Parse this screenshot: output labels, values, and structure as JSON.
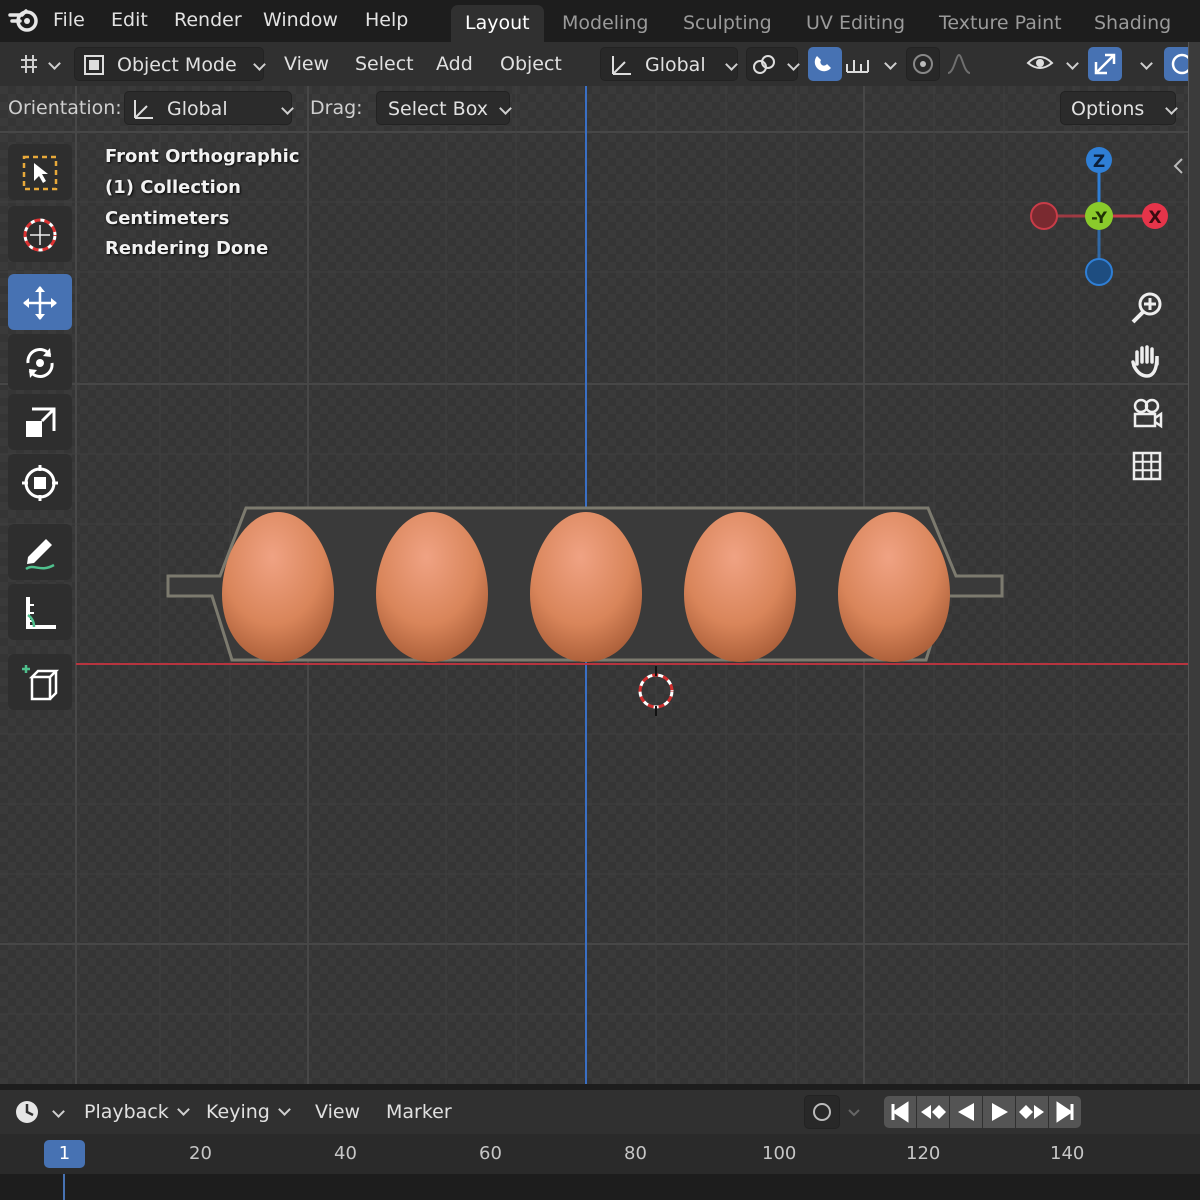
{
  "topbar": {
    "menus": [
      "File",
      "Edit",
      "Render",
      "Window",
      "Help"
    ],
    "workspaces": [
      "Layout",
      "Modeling",
      "Sculpting",
      "UV Editing",
      "Texture Paint",
      "Shading"
    ],
    "active_workspace": "Layout"
  },
  "header": {
    "mode": "Object Mode",
    "menus": [
      "View",
      "Select",
      "Add",
      "Object"
    ],
    "transform_orientation": "Global"
  },
  "header2": {
    "orientation_label": "Orientation:",
    "orientation_value": "Global",
    "drag_label": "Drag:",
    "drag_value": "Select Box",
    "options": "Options"
  },
  "viewport": {
    "view_name": "Front Orthographic",
    "collection": "(1) Collection",
    "units": "Centimeters",
    "status": "Rendering Done",
    "egg_count": 5
  },
  "gizmo": {
    "z": "Z",
    "y": "-Y",
    "x": "X"
  },
  "tools": [
    "select-box-icon",
    "cursor-icon",
    "move-icon",
    "rotate-icon",
    "scale-icon",
    "transform-icon",
    "annotate-icon",
    "measure-icon",
    "add-cube-icon"
  ],
  "timeline": {
    "menus": [
      "Playback",
      "Keying",
      "View",
      "Marker"
    ],
    "current_frame": "1",
    "ticks": [
      "20",
      "40",
      "60",
      "80",
      "100",
      "120",
      "140"
    ]
  },
  "colors": {
    "accent": "#4772b3",
    "x_axis": "#c93c48",
    "y_axis": "#8acb2b",
    "z_axis": "#2f7fd6",
    "egg": "#d9855a"
  }
}
